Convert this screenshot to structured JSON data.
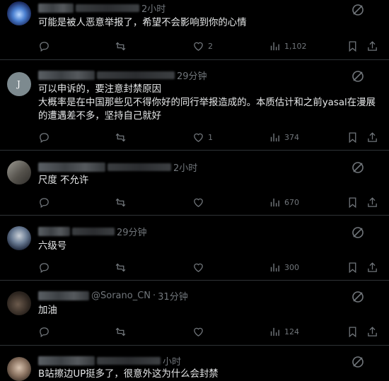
{
  "tweets": [
    {
      "handle_visible": "",
      "time": "2小时",
      "text": "可能是被人恶意举报了，希望不会影响到你的心情",
      "likes": "2",
      "views": "1,102"
    },
    {
      "handle_visible": "",
      "time": "29分钟",
      "text": "可以申诉的，要注意封禁原因\n大概率是在中国那些见不得你好的同行举报造成的。本质估计和之前yasal在漫展的遭遇差不多，坚持自己就好",
      "likes": "1",
      "views": "374"
    },
    {
      "handle_visible": "",
      "time": "2小时",
      "text": "尺度 不允许",
      "likes": "",
      "views": "670"
    },
    {
      "handle_visible": "",
      "time": "29分钟",
      "text": "六级号",
      "likes": "",
      "views": "300"
    },
    {
      "handle_visible": "@Sorano_CN",
      "time": "31分钟",
      "text": "加油",
      "likes": "",
      "views": "124"
    },
    {
      "handle_visible": "",
      "time": "小时",
      "text": "B站擦边UP挺多了，很意外这为什么会封禁",
      "likes": "",
      "views": ""
    }
  ],
  "icons": [
    "more-icon",
    "reply-icon",
    "retweet-icon",
    "like-icon",
    "views-icon",
    "bookmark-icon",
    "share-icon"
  ]
}
